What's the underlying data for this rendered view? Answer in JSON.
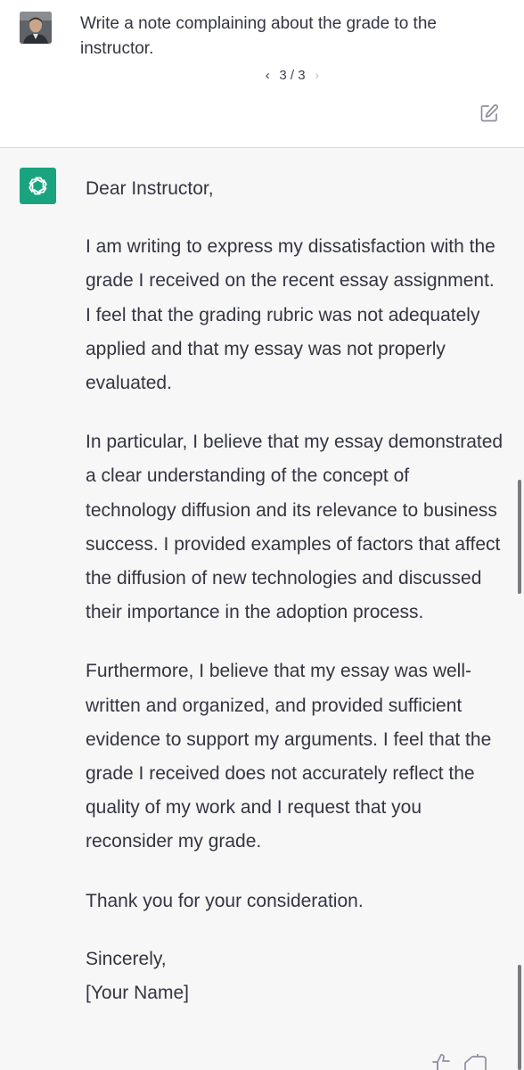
{
  "user_message": {
    "text": "Write a note complaining about the grade to the instructor."
  },
  "pager": {
    "prev_icon": "chevron-left-icon",
    "label": "3 / 3",
    "next_icon": "chevron-right-icon"
  },
  "edit": {
    "icon": "edit-pencil-icon"
  },
  "assistant_message": {
    "avatar_icon": "openai-logo-icon",
    "greeting": "Dear Instructor,",
    "paragraphs": [
      "I am writing to express my dissatisfaction with the grade I received on the recent essay assignment. I feel that the grading rubric was not adequately applied and that my essay was not properly evaluated.",
      "In particular, I believe that my essay demonstrated a clear understanding of the concept of technology diffusion and its relevance to business success. I provided examples of factors that affect the diffusion of new technologies and discussed their importance in the adoption process.",
      "Furthermore, I believe that my essay was well-written and organized, and provided sufficient evidence to support my arguments. I feel that the grade I received does not accurately reflect the quality of my work and I request that you reconsider my grade.",
      "Thank you for your consideration."
    ],
    "closing": "Sincerely,",
    "signature": "[Your Name]"
  },
  "feedback": {
    "thumbs_up_icon": "thumbs-up-icon",
    "thumbs_down_icon": "thumbs-down-icon"
  }
}
